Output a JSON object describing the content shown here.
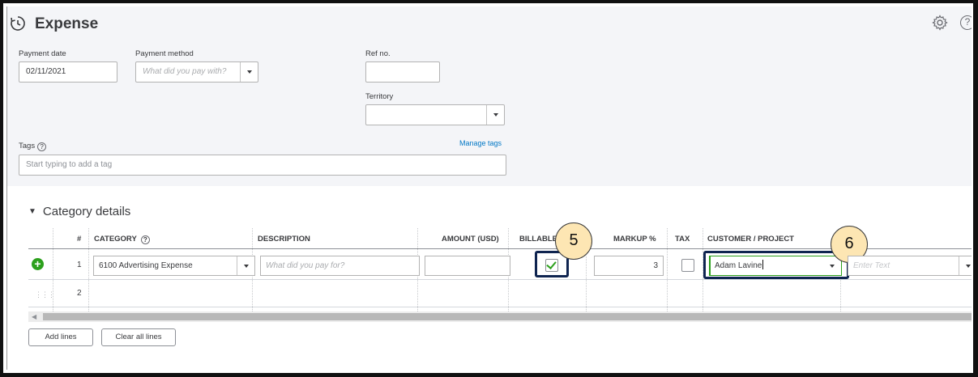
{
  "header": {
    "title": "Expense",
    "help_symbol": "?"
  },
  "form": {
    "payment_date": {
      "label": "Payment date",
      "value": "02/11/2021"
    },
    "payment_method": {
      "label": "Payment method",
      "placeholder": "What did you pay with?"
    },
    "ref_no": {
      "label": "Ref no.",
      "value": ""
    },
    "territory": {
      "label": "Territory",
      "value": ""
    },
    "tags": {
      "label": "Tags",
      "help_symbol": "?",
      "placeholder": "Start typing to add a tag",
      "manage_link": "Manage tags"
    }
  },
  "category_details": {
    "title": "Category details",
    "columns": [
      "#",
      "CATEGORY",
      "DESCRIPTION",
      "AMOUNT (USD)",
      "BILLABLE",
      "MARKUP %",
      "TAX",
      "CUSTOMER / PROJECT"
    ],
    "category_help_symbol": "?",
    "rows": [
      {
        "num": "1",
        "category": "6100 Advertising Expense",
        "description_placeholder": "What did you pay for?",
        "amount": "",
        "billable": true,
        "markup": "3",
        "tax": false,
        "customer": "Adam Lavine",
        "extra_placeholder": "Enter Text"
      },
      {
        "num": "2"
      }
    ]
  },
  "buttons": {
    "add_lines": "Add lines",
    "clear_all_lines": "Clear all lines"
  },
  "callouts": {
    "billable": "5",
    "customer": "6"
  },
  "colors": {
    "accent_green": "#2ca01c",
    "link_blue": "#0077c5",
    "highlight_navy": "#0f2450",
    "callout_fill": "#fde6b3"
  },
  "icons": {
    "app": "expense-clock-icon",
    "settings": "gear-icon",
    "help": "help-icon",
    "add_row": "plus-circle-icon",
    "drag": "drag-handle-icon"
  }
}
